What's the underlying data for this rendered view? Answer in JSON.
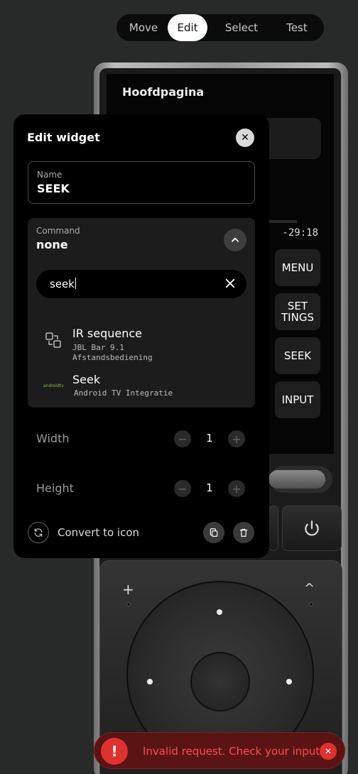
{
  "modes": [
    "Move",
    "Edit",
    "Select",
    "Test"
  ],
  "active_mode": "Edit",
  "remote": {
    "page_title": "Hoofdpagina",
    "time": "-29:18",
    "buttons": [
      "MENU",
      "SET\nTINGS",
      "SEEK",
      "INPUT"
    ]
  },
  "panel": {
    "title": "Edit widget",
    "name_label": "Name",
    "name_value": "SEEK",
    "command_label": "Command",
    "command_value": "none",
    "search_value": "seek",
    "results": [
      {
        "name": "IR sequence",
        "sub1": "JBL Bar 9.1",
        "sub2": "Afstandsbediening",
        "icon": "ir-sequence-icon"
      },
      {
        "name": "Seek",
        "sub1": "Android TV Integratie",
        "icon": "androidtv-logo",
        "logo_text": "androidtv"
      }
    ],
    "width_label": "Width",
    "width_value": "1",
    "height_label": "Height",
    "height_value": "1",
    "convert_label": "Convert to icon"
  },
  "toast": {
    "message": "Invalid request. Check your input.",
    "icon": "!"
  },
  "colors": {
    "accent_error": "#e03131",
    "toast_bg": "#5a1414",
    "androidtv_green": "#7cc043"
  }
}
